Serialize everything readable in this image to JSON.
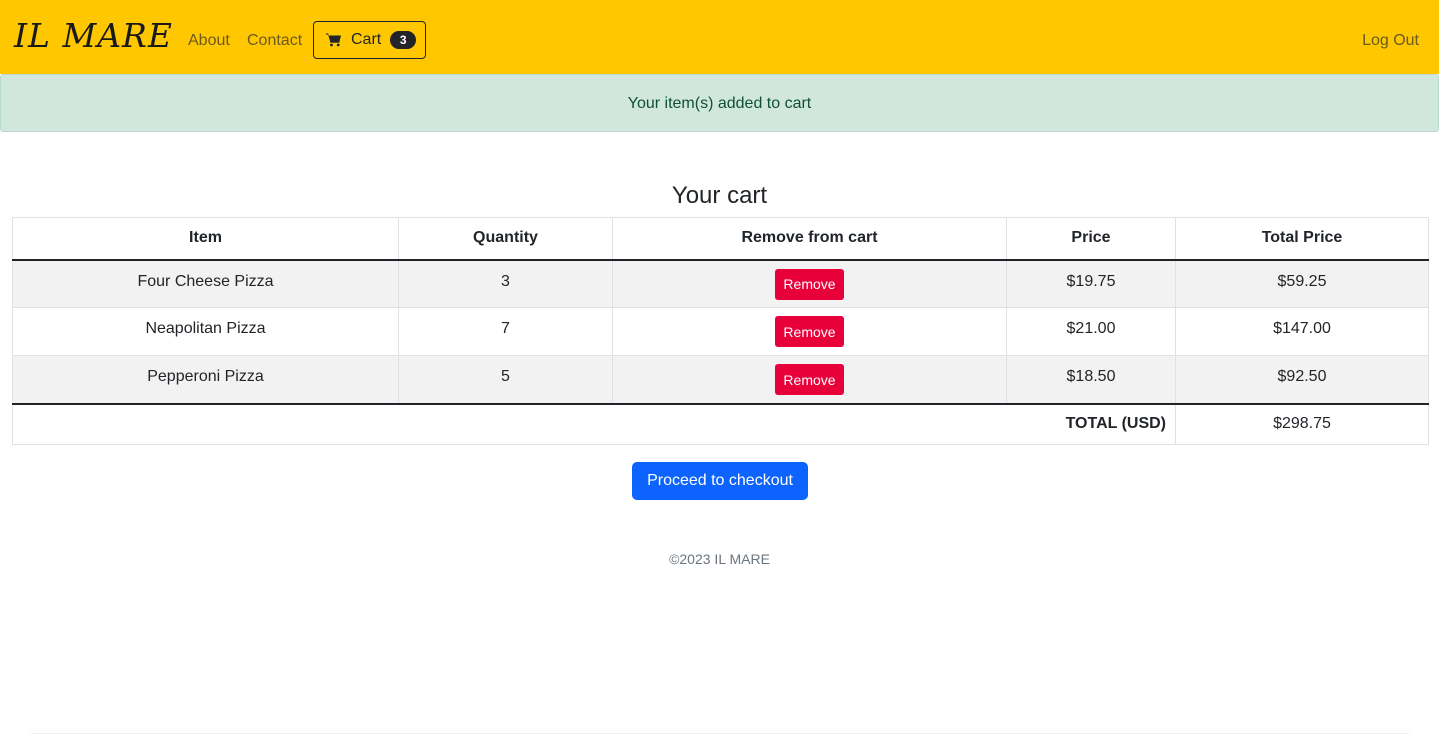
{
  "navbar": {
    "brand": "IL MARE",
    "links": {
      "about": "About",
      "contact": "Contact",
      "logout": "Log Out"
    },
    "cart": {
      "label": "Cart",
      "count": "3",
      "icon": "cart-icon"
    },
    "background_color": "#ffc700"
  },
  "alert": {
    "message": "Your item(s) added to cart",
    "color": "#d1e7dd"
  },
  "cart": {
    "title": "Your cart",
    "headers": [
      "Item",
      "Quantity",
      "Remove from cart",
      "Price",
      "Total Price"
    ],
    "rows": [
      {
        "item": "Four Cheese Pizza",
        "quantity": "3",
        "remove_label": "Remove",
        "price": "$19.75",
        "total": "$59.25"
      },
      {
        "item": "Neapolitan Pizza",
        "quantity": "7",
        "remove_label": "Remove",
        "price": "$21.00",
        "total": "$147.00"
      },
      {
        "item": "Pepperoni Pizza",
        "quantity": "5",
        "remove_label": "Remove",
        "price": "$18.50",
        "total": "$92.50"
      }
    ],
    "total_label": "TOTAL (USD)",
    "total_value": "$298.75",
    "remove_color": "#e8003a"
  },
  "checkout": {
    "label": "Proceed to checkout",
    "color": "#0d63fd"
  },
  "footer": {
    "text": "©2023 IL MARE"
  }
}
